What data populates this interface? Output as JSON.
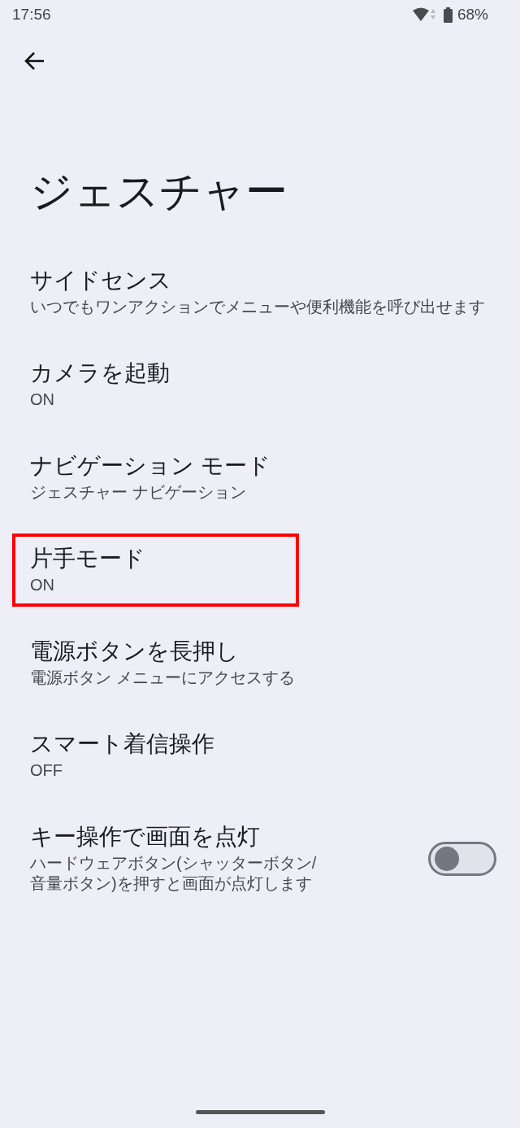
{
  "status_bar": {
    "time": "17:56",
    "battery": "68%"
  },
  "title": "ジェスチャー",
  "items": [
    {
      "kind": "link",
      "title": "サイドセンス",
      "summary": "いつでもワンアクションでメニューや便利機能を呼び出せます",
      "highlighted": false
    },
    {
      "kind": "link",
      "title": "カメラを起動",
      "summary": "ON",
      "highlighted": false
    },
    {
      "kind": "link",
      "title": "ナビゲーション モード",
      "summary": "ジェスチャー ナビゲーション",
      "highlighted": false
    },
    {
      "kind": "link",
      "title": "片手モード",
      "summary": "ON",
      "highlighted": true
    },
    {
      "kind": "link",
      "title": "電源ボタンを長押し",
      "summary": "電源ボタン メニューにアクセスする",
      "highlighted": false
    },
    {
      "kind": "link",
      "title": "スマート着信操作",
      "summary": "OFF",
      "highlighted": false
    },
    {
      "kind": "switch",
      "title": "キー操作で画面を点灯",
      "summary": "ハードウェアボタン(シャッターボタン/音量ボタン)を押すと画面が点灯します",
      "on": false,
      "highlighted": false
    }
  ]
}
